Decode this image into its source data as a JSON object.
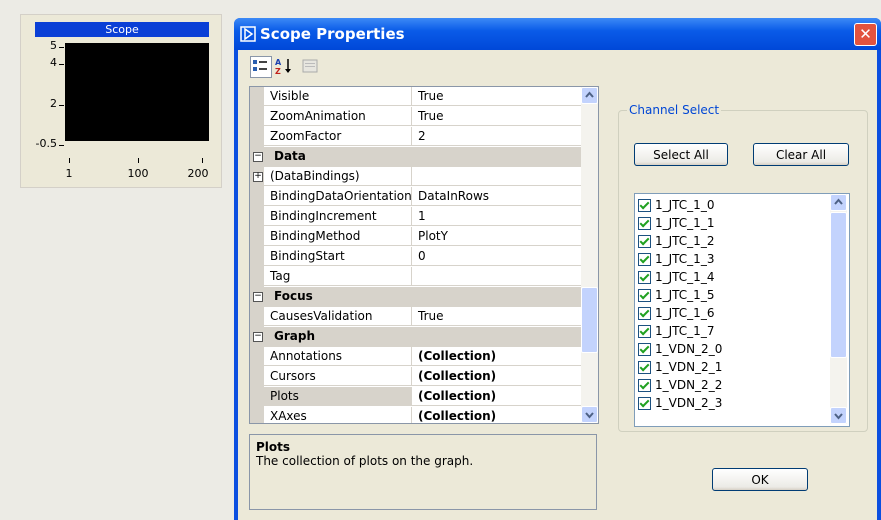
{
  "scope": {
    "title": "Scope",
    "y_ticks": [
      "5",
      "4",
      "2",
      "-0.5"
    ],
    "x_ticks": [
      "1",
      "100",
      "200"
    ]
  },
  "dialog": {
    "title": "Scope Properties",
    "toolbar": {
      "icons": [
        "categorized-icon",
        "alphabetical-sort-icon",
        "property-pages-icon"
      ]
    },
    "property_grid": {
      "rows": [
        {
          "type": "prop",
          "name": "Visible",
          "value": "True"
        },
        {
          "type": "prop",
          "name": "ZoomAnimation",
          "value": "True"
        },
        {
          "type": "prop",
          "name": "ZoomFactor",
          "value": "2"
        },
        {
          "type": "cat",
          "name": "Data"
        },
        {
          "type": "prop",
          "name": "(DataBindings)",
          "value": "",
          "expandable": true
        },
        {
          "type": "prop",
          "name": "BindingDataOrientation",
          "value": "DataInRows"
        },
        {
          "type": "prop",
          "name": "BindingIncrement",
          "value": "1"
        },
        {
          "type": "prop",
          "name": "BindingMethod",
          "value": "PlotY"
        },
        {
          "type": "prop",
          "name": "BindingStart",
          "value": "0"
        },
        {
          "type": "prop",
          "name": "Tag",
          "value": ""
        },
        {
          "type": "cat",
          "name": "Focus"
        },
        {
          "type": "prop",
          "name": "CausesValidation",
          "value": "True"
        },
        {
          "type": "cat",
          "name": "Graph"
        },
        {
          "type": "prop",
          "name": "Annotations",
          "value": "(Collection)",
          "bold": true
        },
        {
          "type": "prop",
          "name": "Cursors",
          "value": "(Collection)",
          "bold": true
        },
        {
          "type": "prop",
          "name": "Plots",
          "value": "(Collection)",
          "bold": true,
          "selected": true
        },
        {
          "type": "prop",
          "name": "XAxes",
          "value": "(Collection)",
          "bold": true
        }
      ]
    },
    "description": {
      "title": "Plots",
      "text": "The collection of plots on the graph."
    },
    "channel_select": {
      "legend": "Channel Select",
      "select_all": "Select All",
      "clear_all": "Clear All",
      "channels": [
        {
          "label": "1_JTC_1_0",
          "checked": true
        },
        {
          "label": "1_JTC_1_1",
          "checked": true
        },
        {
          "label": "1_JTC_1_2",
          "checked": true
        },
        {
          "label": "1_JTC_1_3",
          "checked": true
        },
        {
          "label": "1_JTC_1_4",
          "checked": true
        },
        {
          "label": "1_JTC_1_5",
          "checked": true
        },
        {
          "label": "1_JTC_1_6",
          "checked": true
        },
        {
          "label": "1_JTC_1_7",
          "checked": true
        },
        {
          "label": "1_VDN_2_0",
          "checked": true
        },
        {
          "label": "1_VDN_2_1",
          "checked": true
        },
        {
          "label": "1_VDN_2_2",
          "checked": true
        },
        {
          "label": "1_VDN_2_3",
          "checked": true
        }
      ]
    },
    "ok_label": "OK",
    "colors": {
      "titlebar": "#0a5be8",
      "close_button": "#e2533e",
      "scope_title_bg": "#0a3fd6",
      "check_mark": "#21a121",
      "group_legend": "#0046d5"
    }
  }
}
